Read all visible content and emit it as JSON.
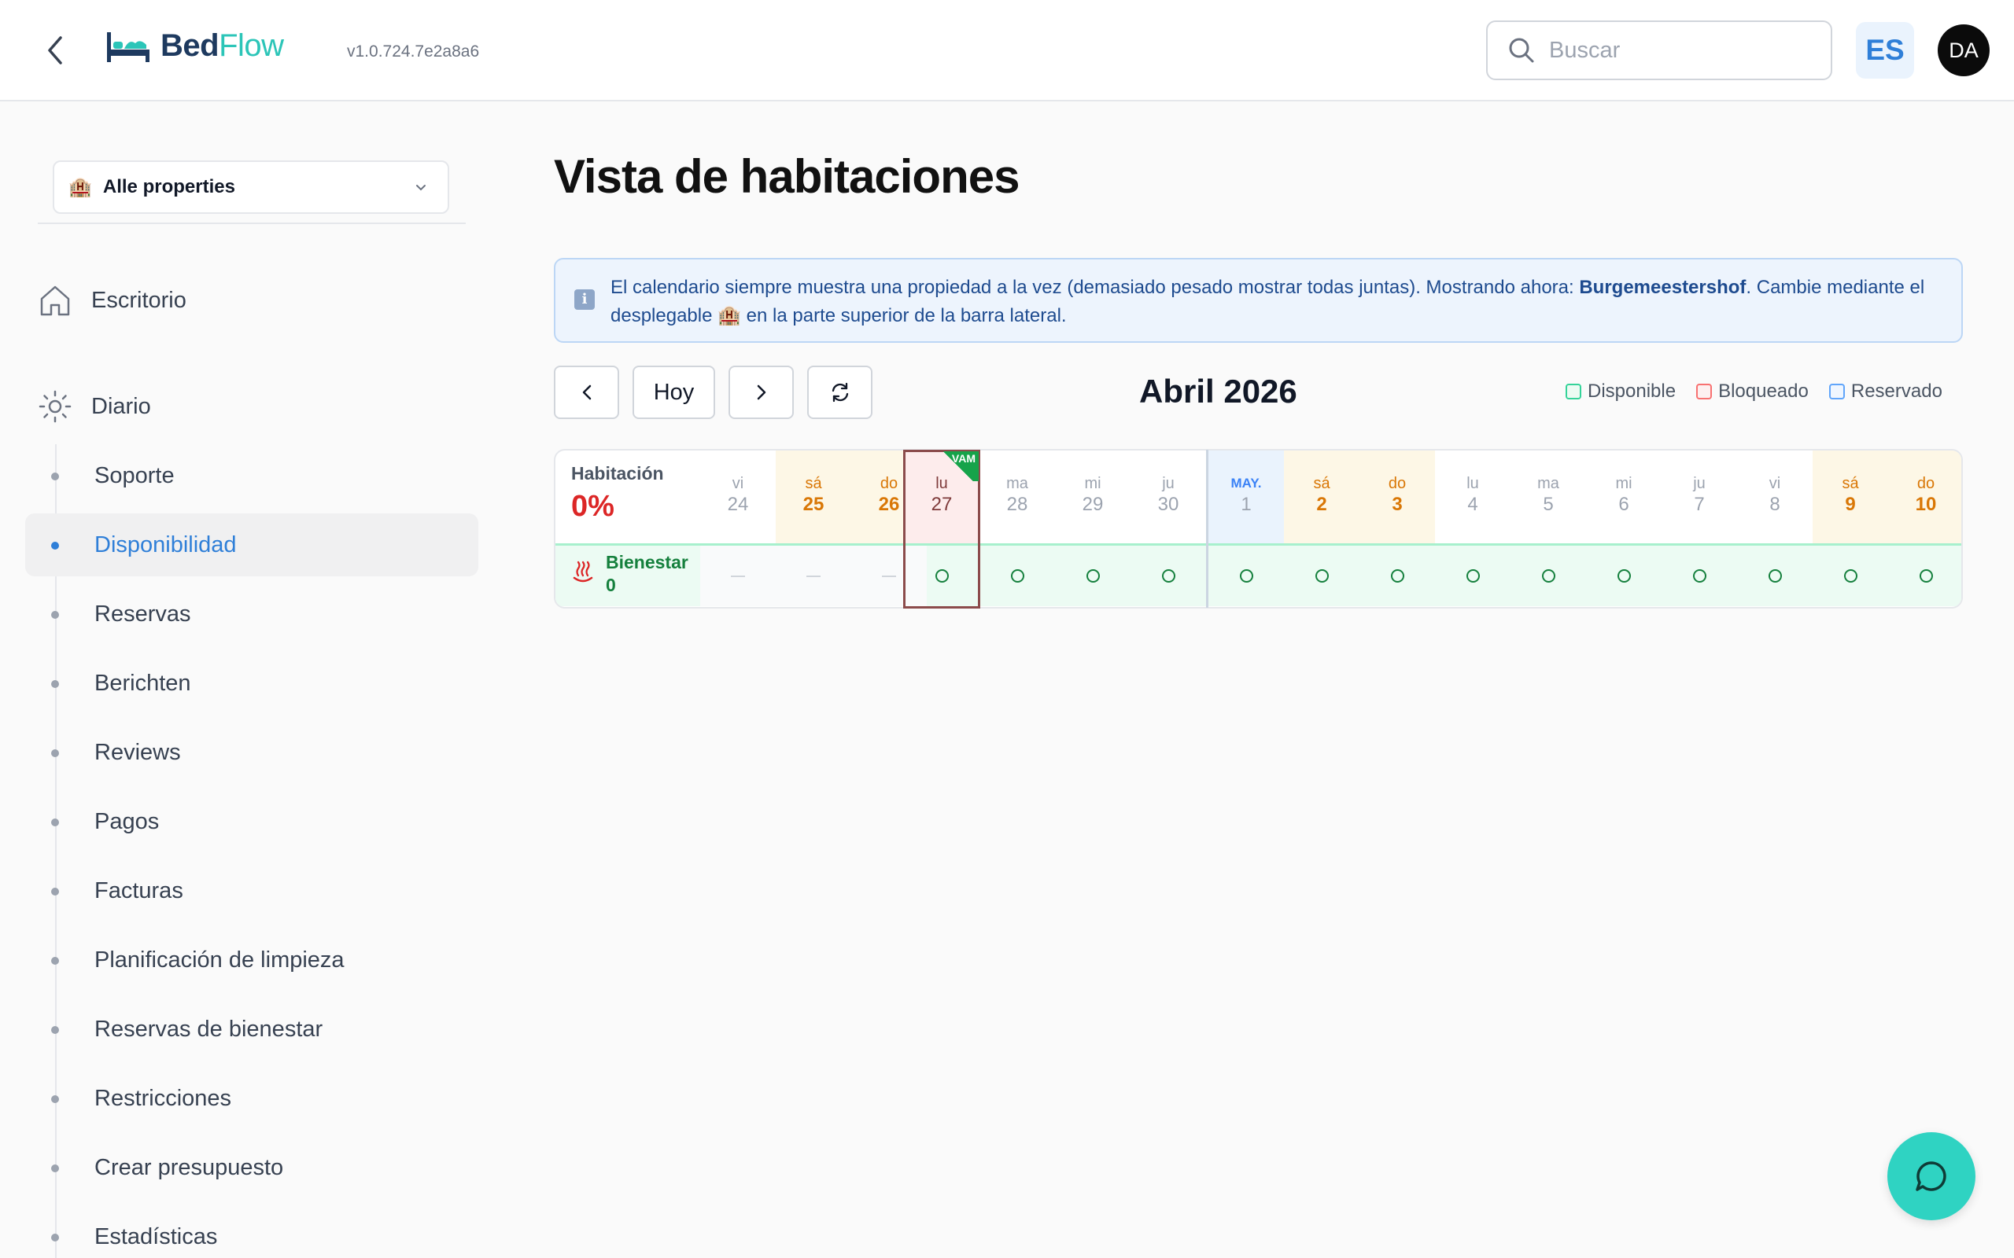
{
  "header": {
    "app_name_part1": "Bed",
    "app_name_part2": "Flow",
    "version": "v1.0.724.7e2a8a6",
    "search_placeholder": "Buscar",
    "language": "ES",
    "user_initials": "DA"
  },
  "sidebar": {
    "property_select": "Alle properties",
    "top_items": [
      {
        "label": "Escritorio",
        "icon": "home-icon"
      },
      {
        "label": "Diario",
        "icon": "sun-icon"
      }
    ],
    "sub_items": [
      {
        "label": "Soporte",
        "active": false
      },
      {
        "label": "Disponibilidad",
        "active": true
      },
      {
        "label": "Reservas",
        "active": false
      },
      {
        "label": "Berichten",
        "active": false
      },
      {
        "label": "Reviews",
        "active": false
      },
      {
        "label": "Pagos",
        "active": false
      },
      {
        "label": "Facturas",
        "active": false
      },
      {
        "label": "Planificación de limpieza",
        "active": false
      },
      {
        "label": "Reservas de bienestar",
        "active": false
      },
      {
        "label": "Restricciones",
        "active": false
      },
      {
        "label": "Crear presupuesto",
        "active": false
      },
      {
        "label": "Estadísticas",
        "active": false
      }
    ]
  },
  "main": {
    "title": "Vista de habitaciones",
    "info": {
      "text_before": "El calendario siempre muestra una propiedad a la vez (demasiado pesado mostrar todas juntas). Mostrando ahora: ",
      "property": "Burgemeestershof",
      "text_after": ". Cambie mediante el desplegable 🏨 en la parte superior de la barra lateral."
    },
    "toolbar": {
      "today_label": "Hoy",
      "month_title": "Abril 2026"
    },
    "legend": [
      {
        "label": "Disponible",
        "color": "#34d399"
      },
      {
        "label": "Bloqueado",
        "color": "#f87171"
      },
      {
        "label": "Reservado",
        "color": "#60a5fa"
      }
    ],
    "calendar": {
      "room_header": "Habitación",
      "occupancy": "0%",
      "today_tag": "VAM",
      "room": {
        "name": "Bienestar",
        "count": "0"
      },
      "days": [
        {
          "wd": "vi",
          "dn": "24",
          "type": "past"
        },
        {
          "wd": "sá",
          "dn": "25",
          "type": "weekend-past"
        },
        {
          "wd": "do",
          "dn": "26",
          "type": "weekend-past"
        },
        {
          "wd": "lu",
          "dn": "27",
          "type": "today"
        },
        {
          "wd": "ma",
          "dn": "28",
          "type": "normal"
        },
        {
          "wd": "mi",
          "dn": "29",
          "type": "normal"
        },
        {
          "wd": "ju",
          "dn": "30",
          "type": "normal"
        },
        {
          "wd": "MAY.",
          "dn": "1",
          "type": "month-start"
        },
        {
          "wd": "sá",
          "dn": "2",
          "type": "weekend"
        },
        {
          "wd": "do",
          "dn": "3",
          "type": "weekend"
        },
        {
          "wd": "lu",
          "dn": "4",
          "type": "normal"
        },
        {
          "wd": "ma",
          "dn": "5",
          "type": "normal"
        },
        {
          "wd": "mi",
          "dn": "6",
          "type": "normal"
        },
        {
          "wd": "ju",
          "dn": "7",
          "type": "normal"
        },
        {
          "wd": "vi",
          "dn": "8",
          "type": "normal"
        },
        {
          "wd": "sá",
          "dn": "9",
          "type": "weekend"
        },
        {
          "wd": "do",
          "dn": "10",
          "type": "weekend"
        }
      ],
      "cells": [
        "—",
        "—",
        "—",
        "○",
        "○",
        "○",
        "○",
        "○",
        "○",
        "○",
        "○",
        "○",
        "○",
        "○",
        "○",
        "○",
        "○"
      ]
    }
  },
  "colors": {
    "accent": "#2f7fd8",
    "brand_teal": "#2cc5b8",
    "available": "#15803d",
    "occupancy": "#dc2626"
  }
}
